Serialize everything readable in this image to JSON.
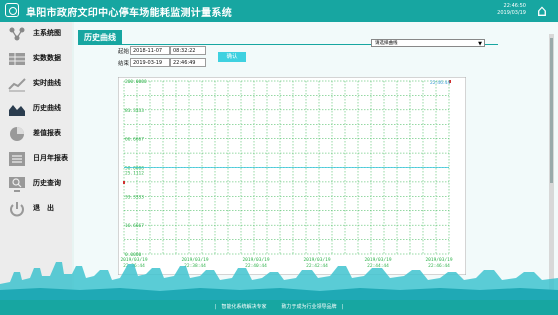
{
  "header": {
    "title": "阜阳市政府文印中心停车场能耗监测计量系统",
    "time": "22:46:50",
    "date": "2019/03/19"
  },
  "sidebar": {
    "items": [
      {
        "label": "主系统图",
        "icon": "nodes-icon"
      },
      {
        "label": "实数数据",
        "icon": "table-icon"
      },
      {
        "label": "实时曲线",
        "icon": "trend-icon"
      },
      {
        "label": "历史曲线",
        "icon": "area-chart-icon"
      },
      {
        "label": "差值报表",
        "icon": "pie-icon"
      },
      {
        "label": "日月年报表",
        "icon": "report-icon"
      },
      {
        "label": "历史查询",
        "icon": "search-monitor-icon"
      },
      {
        "label": "退　出",
        "icon": "power-icon"
      }
    ]
  },
  "section": {
    "title": "历史曲线"
  },
  "query": {
    "start_label": "起始：",
    "start_date": "2018-11-07",
    "start_time": "08:32:22",
    "end_label": "结束：",
    "end_date": "2019-03-19",
    "end_time": "22:46:49",
    "confirm_label": "确认",
    "select_value": "请选择曲线"
  },
  "cursor_readout": "22:46:44",
  "footer": {
    "text": "|　智能化系统解决专家　　　致力于成为行业领导品牌　|"
  },
  "colors": {
    "accent": "#17a6a1",
    "grid": "#2eb24a",
    "line": "#36c6e0"
  },
  "chart_data": {
    "type": "line",
    "y_ticks": [
      "200.0000",
      "83.3333",
      "66.6667",
      "50.0000",
      "33.3333",
      "16.6667",
      "0.0000"
    ],
    "extra_label": "25.1112",
    "ylim": [
      0,
      100
    ],
    "x_ticks": [
      [
        "2019/03/19",
        "22:36:44"
      ],
      [
        "2019/03/19",
        "22:38:44"
      ],
      [
        "2019/03/19",
        "22:40:44"
      ],
      [
        "2019/03/19",
        "22:42:44"
      ],
      [
        "2019/03/19",
        "22:44:44"
      ],
      [
        "2019/03/19",
        "22:46:44"
      ]
    ],
    "series": [
      {
        "values": [
          50,
          50,
          50,
          50,
          50,
          50,
          50,
          50,
          50,
          50,
          50,
          50,
          50,
          50,
          50,
          50,
          50,
          50,
          50,
          50,
          50,
          50,
          50,
          50,
          50,
          50
        ]
      }
    ]
  }
}
